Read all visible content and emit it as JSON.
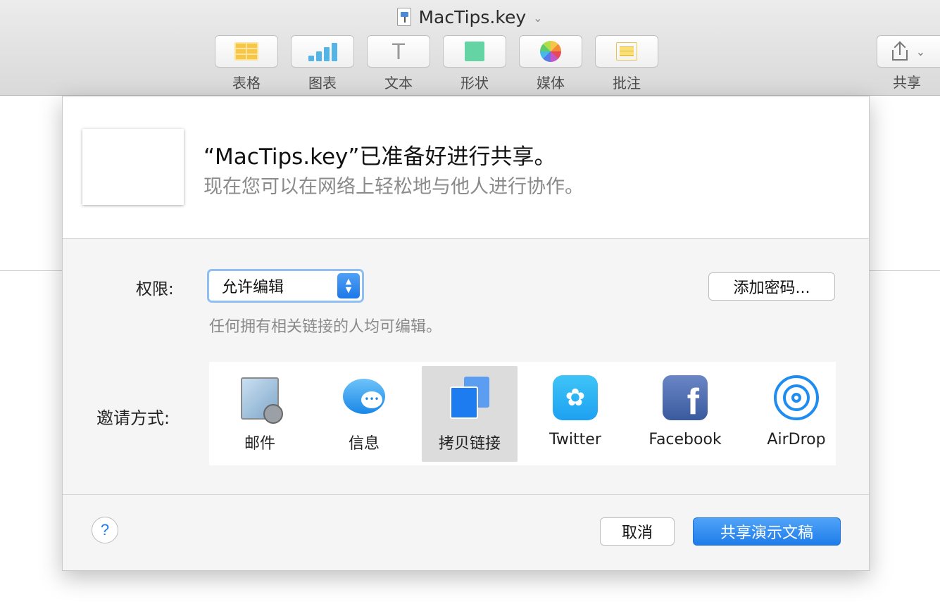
{
  "window": {
    "doc_title": "MacTips.key"
  },
  "toolbar": {
    "items": [
      {
        "label": "表格",
        "icon": "table-icon"
      },
      {
        "label": "图表",
        "icon": "chart-icon"
      },
      {
        "label": "文本",
        "icon": "text-icon"
      },
      {
        "label": "形状",
        "icon": "shape-icon"
      },
      {
        "label": "媒体",
        "icon": "media-icon"
      },
      {
        "label": "批注",
        "icon": "comment-icon"
      }
    ],
    "share_label": "共享",
    "text_glyph": "T"
  },
  "dialog": {
    "title": "“MacTips.key”已准备好进行共享。",
    "subtitle": "现在您可以在网络上轻松地与他人进行协作。",
    "permission_label": "权限:",
    "permission_value": "允许编辑",
    "permission_desc": "任何拥有相关链接的人均可编辑。",
    "add_password": "添加密码...",
    "invite_label": "邀请方式:",
    "invite_options": [
      {
        "label": "邮件",
        "icon": "mail-icon",
        "selected": false
      },
      {
        "label": "信息",
        "icon": "messages-icon",
        "selected": false
      },
      {
        "label": "拷贝链接",
        "icon": "copy-link-icon",
        "selected": true
      },
      {
        "label": "Twitter",
        "icon": "twitter-icon",
        "selected": false
      },
      {
        "label": "Facebook",
        "icon": "facebook-icon",
        "selected": false
      },
      {
        "label": "AirDrop",
        "icon": "airdrop-icon",
        "selected": false
      }
    ],
    "help": "?",
    "cancel": "取消",
    "share_doc": "共享演示文稿"
  },
  "colors": {
    "accent": "#1f7cea",
    "selected_bg": "#dcdcdc"
  }
}
